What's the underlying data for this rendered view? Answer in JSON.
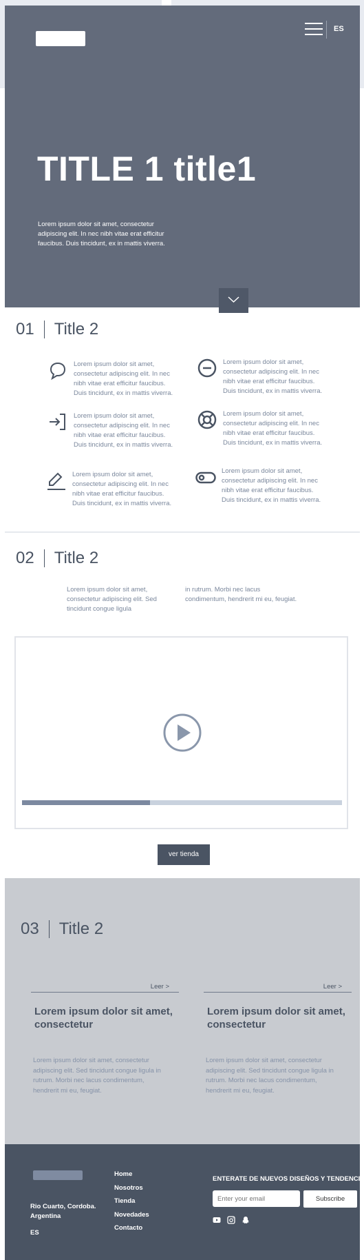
{
  "header": {
    "language": "ES",
    "title": "TITLE 1 title1",
    "text": "Lorem ipsum dolor sit amet, consectetur adipiscing elit. In nec nibh vitae erat efficitur faucibus. Duis tincidunt, ex in mattis viverra."
  },
  "section1": {
    "number": "01",
    "title": "Title 2",
    "features": [
      {
        "icon": "speech-bubble-icon",
        "text": "Lorem ipsum dolor sit amet, consectetur adipiscing elit. In nec nibh vitae erat efficitur faucibus. Duis tincidunt, ex in mattis viverra."
      },
      {
        "icon": "minus-circle-icon",
        "text": "Lorem ipsum dolor sit amet, consectetur adipiscing elit. In nec nibh vitae erat efficitur faucibus. Duis tincidunt, ex in mattis viverra."
      },
      {
        "icon": "sign-in-icon",
        "text": "Lorem ipsum dolor sit amet, consectetur adipiscing elit. In nec nibh vitae erat efficitur faucibus. Duis tincidunt, ex in mattis viverra."
      },
      {
        "icon": "life-ring-icon",
        "text": "Lorem ipsum dolor sit amet, consectetur adipiscing elit. In nec nibh vitae erat efficitur faucibus. Duis tincidunt, ex in mattis viverra."
      },
      {
        "icon": "pencil-icon",
        "text": "Lorem ipsum dolor sit amet, consectetur adipiscing elit. In nec nibh vitae erat efficitur faucibus. Duis tincidunt, ex in mattis viverra."
      },
      {
        "icon": "toggle-icon",
        "text": "Lorem ipsum dolor sit amet, consectetur adipiscing elit. In nec nibh vitae erat efficitur faucibus. Duis tincidunt, ex in mattis viverra."
      }
    ]
  },
  "section2": {
    "number": "02",
    "title": "Title 2",
    "col1": "Lorem ipsum dolor sit amet, consectetur adipiscing elit. Sed tincidunt congue ligula",
    "col2": "in rutrum. Morbi nec lacus condimentum, hendrerit mi eu, feugiat.",
    "video_progress": 0.4,
    "button": "ver tienda"
  },
  "section3": {
    "number": "03",
    "title": "Title 2",
    "cards": [
      {
        "link": "Leer >",
        "title": "Lorem ipsum dolor sit amet, consectetur",
        "text": "Lorem ipsum dolor sit amet, consectetur adipiscing elit. Sed tincidunt congue ligula in rutrum. Morbi nec lacus condimentum, hendrerit mi eu, feugiat."
      },
      {
        "link": "Leer >",
        "title": "Lorem ipsum dolor sit amet, consectetur",
        "text": "Lorem ipsum dolor sit amet, consectetur adipiscing elit. Sed tincidunt congue ligula in rutrum. Morbi nec lacus condimentum, hendrerit mi eu, feugiat."
      }
    ]
  },
  "footer": {
    "address": "Rio Cuarto, Cordoba. Argentina",
    "language": "ES",
    "nav": [
      "Home",
      "Nosotros",
      "Tienda",
      "Novedades",
      "Contacto"
    ],
    "newsletter_title": "ENTERATE DE NUEVOS DISEÑOS Y TENDENCIAS!",
    "email_placeholder": "Enter your email",
    "subscribe": "Subscribe",
    "social": [
      "youtube-icon",
      "instagram-icon",
      "snapchat-icon"
    ]
  },
  "colors": {
    "hero_bg": "#636b7b",
    "dark": "#4a5463",
    "muted_text": "#7a879c",
    "section3_bg": "#c8cbd0"
  }
}
